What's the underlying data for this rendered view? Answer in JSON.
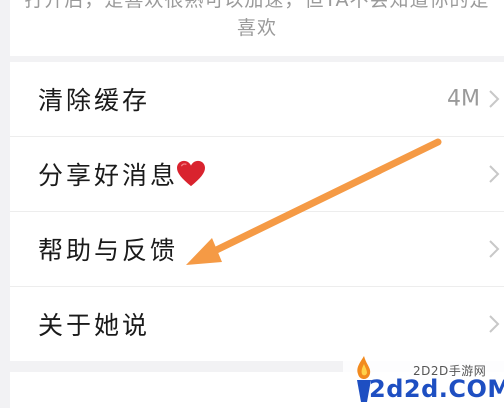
{
  "top_note": {
    "line1": "打开后，是喜欢很熟可以加速，但TA不会知道你的是",
    "line2": "喜欢"
  },
  "settings": [
    {
      "label": "清除缓存",
      "value": "4M"
    },
    {
      "label": "分享好消息",
      "value": ""
    },
    {
      "label": "帮助与反馈",
      "value": ""
    },
    {
      "label": "关于她说",
      "value": ""
    }
  ],
  "watermark": {
    "small_text": "2D2D手游网",
    "big_text": "2d2d.COM"
  },
  "colors": {
    "arrow": "#f59a45",
    "heart": "#d9232e",
    "watermark_blue": "#1e4fc2"
  }
}
